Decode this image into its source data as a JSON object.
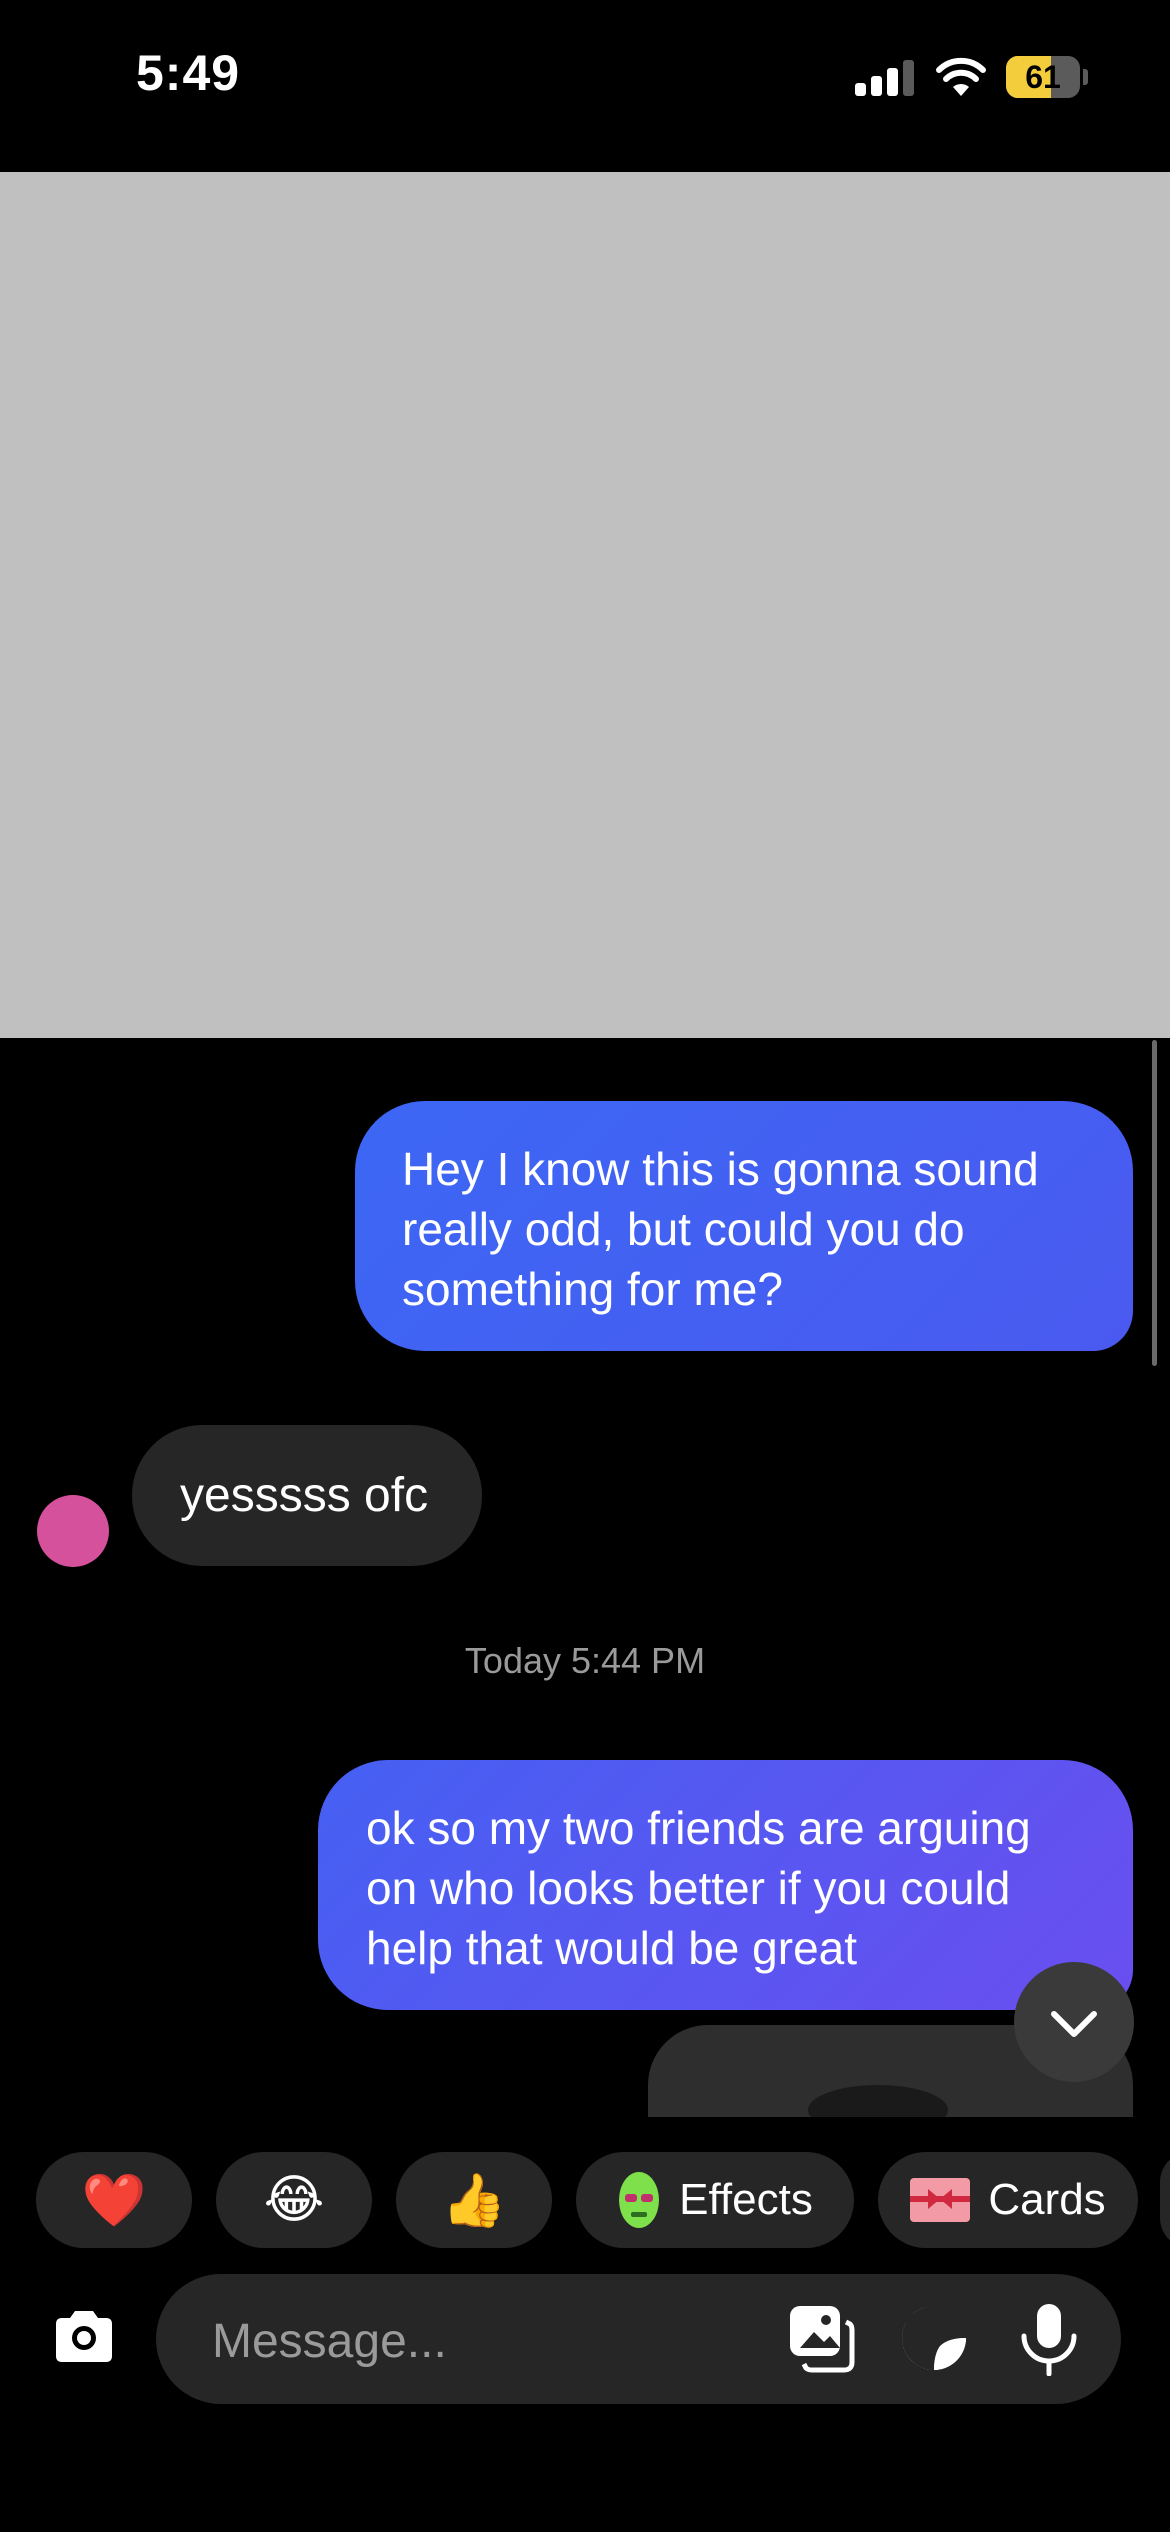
{
  "status_bar": {
    "time": "5:49",
    "battery_level": "61",
    "battery_fraction": 0.61,
    "signal_bars_active": 3,
    "signal_bars_total": 4
  },
  "thread": {
    "messages": [
      {
        "direction": "sent",
        "text": "Hey I know this is gonna sound really odd, but could you do something for me?"
      },
      {
        "direction": "received",
        "text": "yesssss ofc"
      },
      {
        "type": "timestamp",
        "text": "Today 5:44 PM"
      },
      {
        "direction": "sent",
        "text": "ok so my two friends are arguing on who looks better if you could help that would be great"
      }
    ]
  },
  "quick_replies": [
    {
      "icon": "heart-emoji",
      "emoji": "❤️"
    },
    {
      "icon": "laughing-emoji",
      "emoji": "😂"
    },
    {
      "icon": "thumbs-up-emoji",
      "emoji": "👍"
    },
    {
      "icon": "effects-icon",
      "label": "Effects"
    },
    {
      "icon": "cards-icon",
      "label": "Cards"
    }
  ],
  "composer": {
    "placeholder": "Message..."
  },
  "colors": {
    "sent_bubble": "#3c67f4",
    "received_bubble": "#262626",
    "avatar": "#d6519c",
    "battery": "#f4cd3c"
  }
}
